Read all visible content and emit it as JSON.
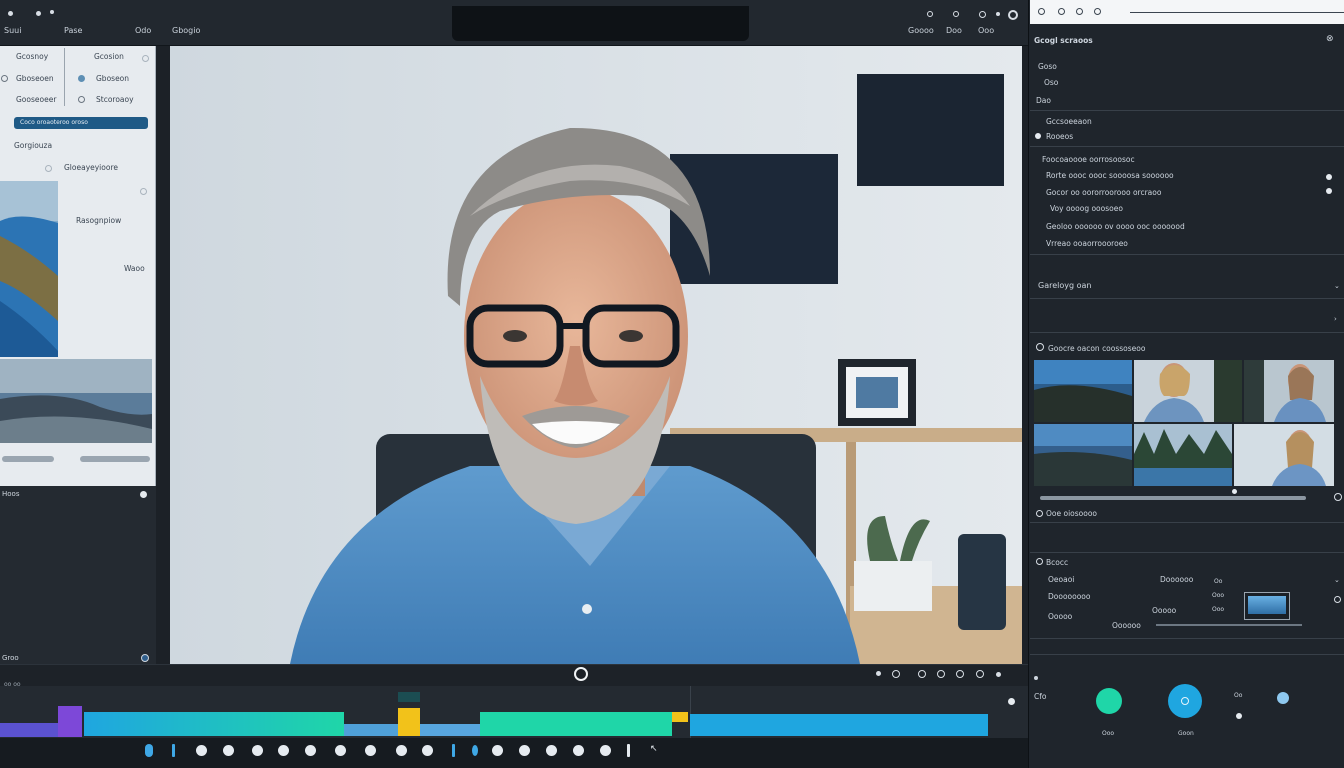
{
  "topbar": {
    "menu_left": "Suui",
    "menu_mid": "Pase",
    "menu_a": "Odo",
    "menu_b": "Gbogio"
  },
  "left_panel": {
    "col1": [
      "Gcosnoy",
      "Gboseoen",
      "Gooseoeer"
    ],
    "col2": [
      "Gcosion",
      "Gboseon",
      "Stcoroaoy"
    ],
    "selected": "Coco oroaoteroo oroso",
    "item4": "Gorgiouza",
    "item5": "Gloeayeyioore",
    "item6": "Rasognpiow",
    "item7": "Waoo",
    "footer_a": "Hoos",
    "footer_b": "Groo"
  },
  "right_panel": {
    "header": "Gcogl scraoos",
    "items": [
      "Goso",
      "Oso",
      "Dao"
    ],
    "sub1": "Gccsoeeaon",
    "sub2": "Rooeos",
    "list_title": "Foocoaoooe oorrosoosoc",
    "list": [
      "Rorte oooc oooc soooosa soooooo",
      "Gocor oo oororroorooo orcraoo",
      "Voy oooog ooosoeo",
      "Geoloo oooooo ov oooo ooc ooooood",
      "Vrreao ooaorroooroeo"
    ],
    "section2": "Gareloyg oan",
    "gallery_title": "Goocre oacon coossoseoo",
    "gallery_caption": "Ooe oiosoooo",
    "settings_title": "Bcocc",
    "settings_rows": [
      "Oeoaoi",
      "Doooooooo",
      "Ooooo"
    ],
    "settings_vals": [
      "Doooooo",
      "Oooooo",
      "Ooooo"
    ],
    "footer_label": "Cfo",
    "btn_a": "Ooo",
    "btn_b": "Goon"
  },
  "colors": {
    "accent_blue": "#1fa6e0",
    "accent_green": "#1fd6a8",
    "accent_yellow": "#f2c21a",
    "accent_purple": "#7d48d8"
  }
}
